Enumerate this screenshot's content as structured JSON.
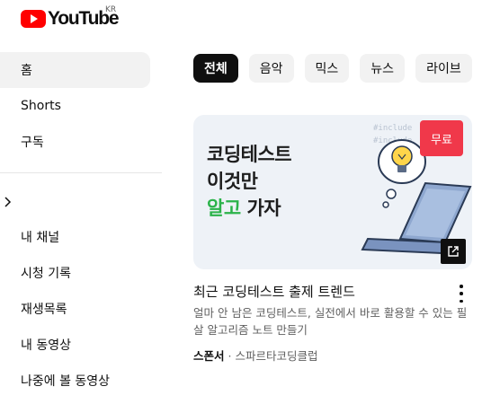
{
  "logo": {
    "wordmark": "YouTube",
    "region": "KR"
  },
  "sidebar": {
    "items": [
      {
        "label": "홈",
        "active": true
      },
      {
        "label": "Shorts"
      },
      {
        "label": "구독"
      }
    ],
    "you_items": [
      {
        "label": "내 채널"
      },
      {
        "label": "시청 기록"
      },
      {
        "label": "재생목록"
      },
      {
        "label": "내 동영상"
      },
      {
        "label": "나중에 볼 동영상"
      }
    ]
  },
  "chips": [
    {
      "label": "전체",
      "active": true
    },
    {
      "label": "음악"
    },
    {
      "label": "믹스"
    },
    {
      "label": "뉴스"
    },
    {
      "label": "라이브"
    }
  ],
  "ad": {
    "thumbnail": {
      "line1": "코딩테스트",
      "line2": "이것만",
      "line3_green": "알고",
      "line3_rest": "가자",
      "badge": "무료"
    },
    "title": "최근 코딩테스트 출제 트렌드",
    "description": "얼마 안 남은 코딩테스트, 실전에서 바로 활용할 수 있는 필살 알고리즘 노트 만들기",
    "sponsor_label": "스폰서",
    "advertiser": "스파르타코딩클럽"
  },
  "colors": {
    "brand_red": "#ff0000",
    "badge_red": "#f0384a",
    "accent_green": "#2bb34a"
  }
}
